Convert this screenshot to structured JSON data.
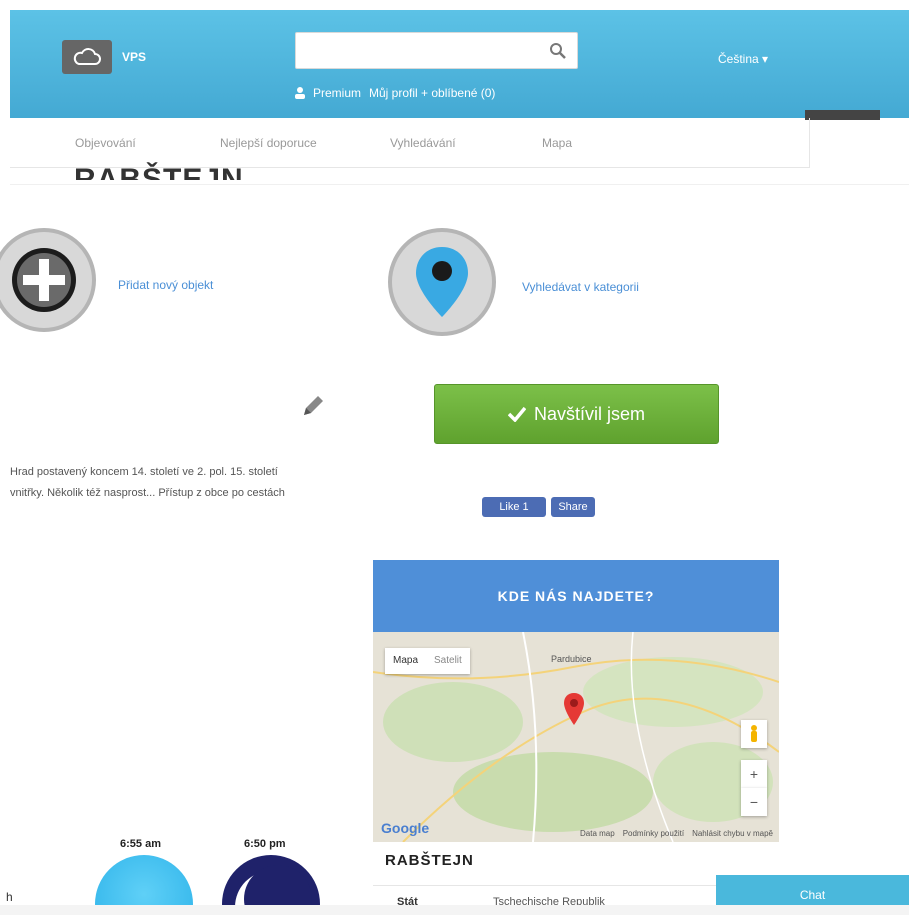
{
  "header": {
    "brand": "VPS",
    "search": {
      "value": "",
      "placeholder": ""
    },
    "premium_label": "Premium",
    "profile_label": "Můj profil + oblíbené (0)",
    "language": "Čeština ▾"
  },
  "tabs": [
    "Objevování",
    "Nejlepší doporuce",
    "Vyhledávání",
    "Mapa"
  ],
  "page_title": "RABŠTEJN",
  "actions": {
    "add_photo": "Přidat nový objekt",
    "search_category": "Vyhledávat v kategorii"
  },
  "description": [
    "Hrad postavený koncem 14. století ve 2. pol. 15. století",
    "vnitřky. Několik též nasprost... Přístup z obce po cestách"
  ],
  "visited_button": "Navštívil jsem",
  "social": {
    "like": "Like 1",
    "share": "Share"
  },
  "map": {
    "heading": "KDE NÁS NAJDETE?",
    "toggle": [
      "Mapa",
      "Satelit"
    ],
    "labels": [
      "Pardubice"
    ],
    "footer": [
      "Data map",
      "Podmínky použití",
      "Nahlásit chybu v mapě"
    ],
    "google": "Google"
  },
  "place": {
    "name": "RABŠTEJN",
    "row": {
      "key": "Stát",
      "value": "Tschechische Republik"
    }
  },
  "sun": {
    "sunrise": "6:55 am",
    "sunset": "6:50 pm"
  },
  "chat": "Chat",
  "colors": {
    "header": "#4cb2da",
    "visited": "#6aae38",
    "map_head": "#4f8fd8",
    "chat": "#4ab8dc"
  }
}
